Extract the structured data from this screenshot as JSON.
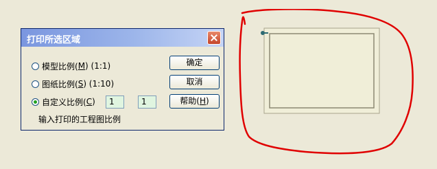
{
  "dialog": {
    "title": "打印所选区域",
    "options": [
      {
        "label": "模型比例(",
        "key": "M",
        "suffix": ") (1:1)",
        "checked": false
      },
      {
        "label": "图纸比例(",
        "key": "S",
        "suffix": ") (1:10)",
        "checked": false
      },
      {
        "label": "自定义比例(",
        "key": "C",
        "suffix": ")",
        "checked": true
      }
    ],
    "buttons": {
      "ok": "确定",
      "cancel": "取消",
      "help_prefix": "帮助(",
      "help_key": "H",
      "help_suffix": ")"
    },
    "custom_ratio": {
      "left": "1",
      "separator": ":",
      "right": "1"
    },
    "hint": "输入打印的工程图比例"
  },
  "colors": {
    "annotation": "#e00000",
    "preview_bg": "#f0eed8",
    "title_gradient_start": "#7a96df"
  }
}
